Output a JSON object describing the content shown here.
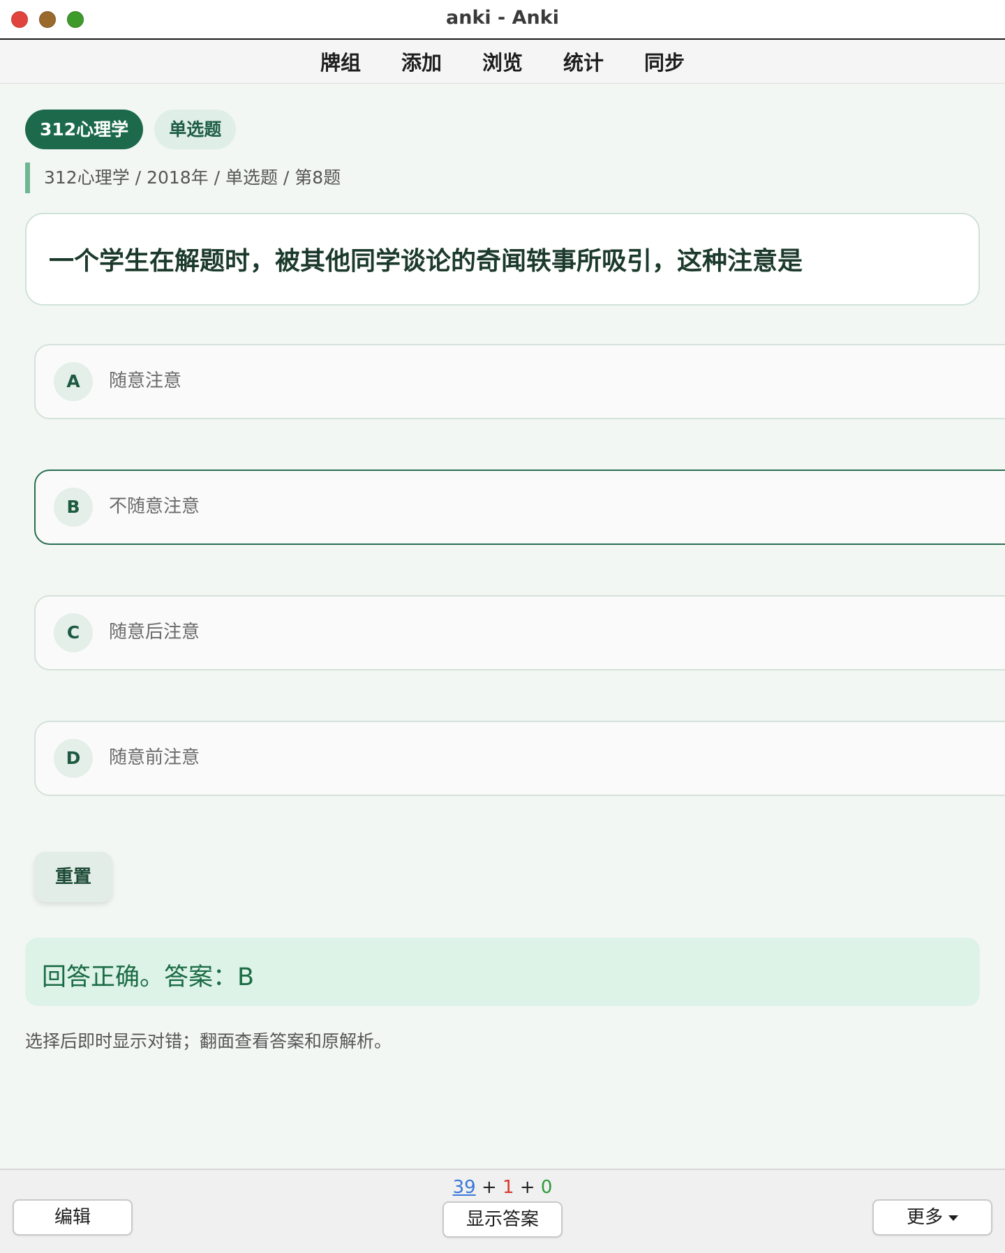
{
  "window": {
    "title": "anki - Anki"
  },
  "toolbar": {
    "items": [
      "牌组",
      "添加",
      "浏览",
      "统计",
      "同步"
    ]
  },
  "card": {
    "tags": [
      "312心理学",
      "单选题"
    ],
    "breadcrumb": "312心理学 / 2018年 / 单选题 / 第8题",
    "question": "一个学生在解题时，被其他同学谈论的奇闻轶事所吸引，这种注意是",
    "options": [
      {
        "letter": "A",
        "text": "随意注意"
      },
      {
        "letter": "B",
        "text": "不随意注意"
      },
      {
        "letter": "C",
        "text": "随意后注意"
      },
      {
        "letter": "D",
        "text": "随意前注意"
      }
    ],
    "selected_option": "B",
    "reset_label": "重置",
    "result": "回答正确。答案：B",
    "hint": "选择后即时显示对错；翻面查看答案和原解析。"
  },
  "bottombar": {
    "counts": {
      "new": "39",
      "learn": "1",
      "review": "0",
      "separator": "+"
    },
    "edit_label": "编辑",
    "show_answer_label": "显示答案",
    "more_label": "更多"
  },
  "colors": {
    "accent": "#1c6a4b",
    "background": "#f3f7f4",
    "result_bg": "#ddf3e8",
    "count_new": "#3a78d8",
    "count_learn": "#d63a2e",
    "count_review": "#2e9a3a"
  }
}
